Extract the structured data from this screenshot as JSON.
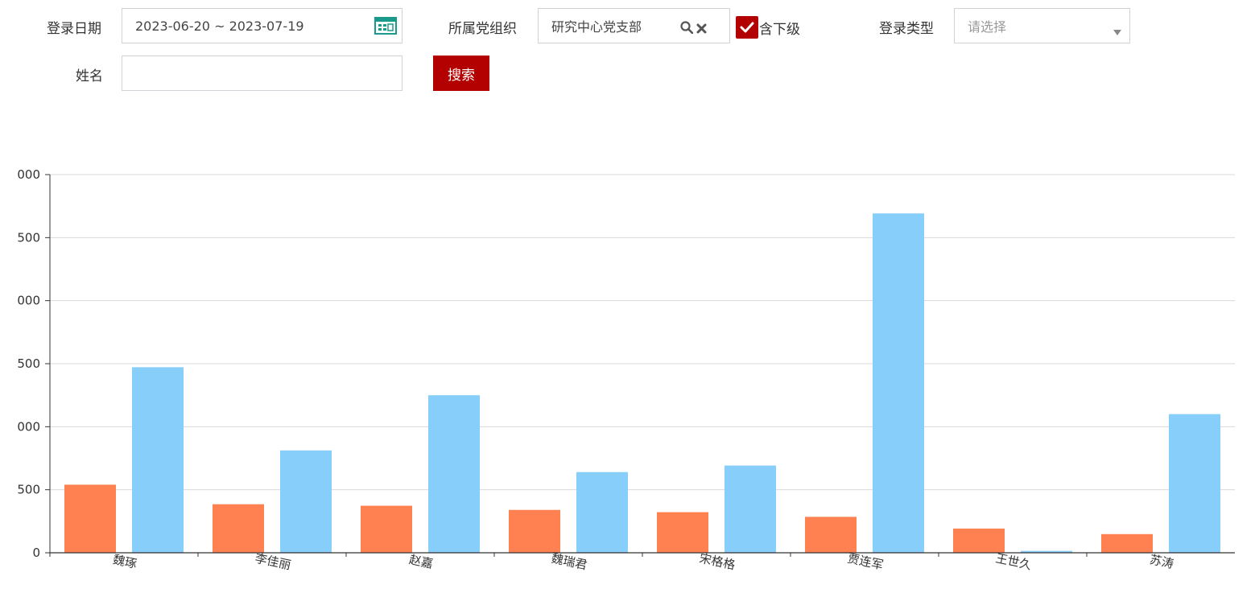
{
  "filters": {
    "date_label": "登录日期",
    "date_value": "2023-06-20 ~ 2023-07-19",
    "org_label": "所属党组织",
    "org_value": "研究中心党支部",
    "include_sub_label": "含下级",
    "login_type_label": "登录类型",
    "login_type_placeholder": "请选择",
    "name_label": "姓名",
    "name_value": "",
    "search_button": "搜索"
  },
  "colors": {
    "accent": "#b30000",
    "series1": "#ff8050",
    "series2": "#87cefa",
    "calendar": "#1a9a8a"
  },
  "chart_data": {
    "type": "bar",
    "categories": [
      "魏琢",
      "李佳丽",
      "赵嘉",
      "魏瑞君",
      "宋格格",
      "贾连军",
      "王世久",
      "苏涛"
    ],
    "series": [
      {
        "values": [
          540,
          385,
          373,
          340,
          322,
          285,
          192,
          148
        ]
      },
      {
        "values": [
          1472,
          812,
          1250,
          640,
          692,
          2692,
          15,
          1100
        ]
      }
    ],
    "y_tick_labels": [
      "0",
      "500",
      "000",
      "500",
      "000",
      "500",
      "000"
    ],
    "ylim": [
      0,
      3000
    ],
    "grid": true
  }
}
